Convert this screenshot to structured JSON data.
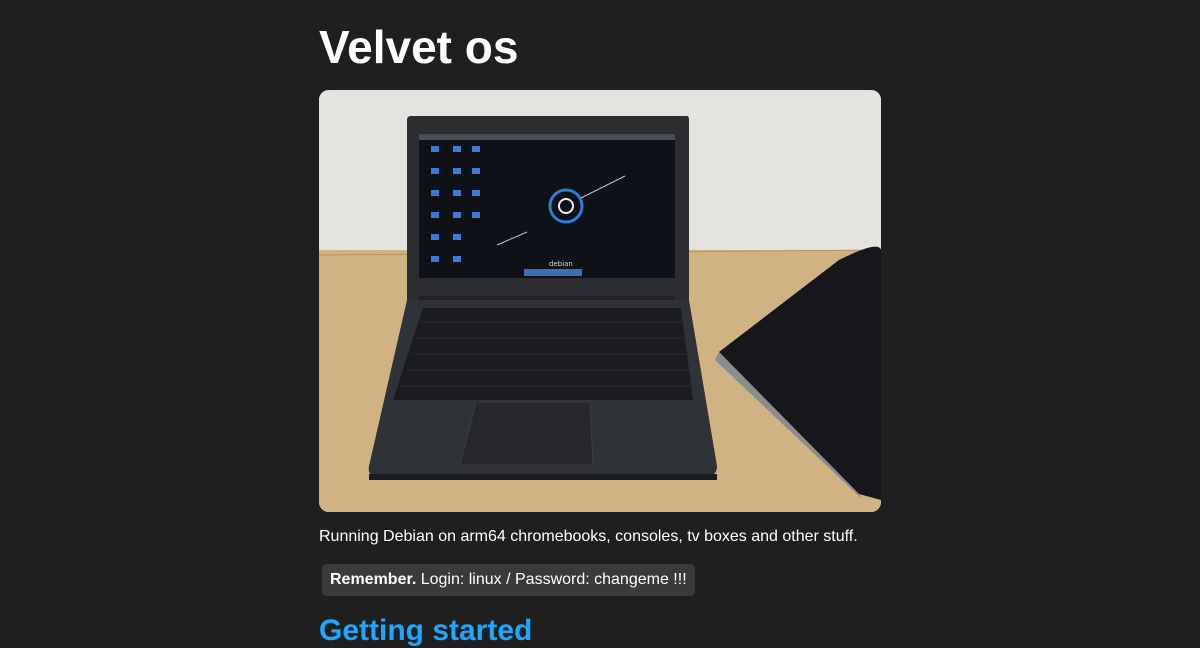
{
  "header": {
    "title": "Velvet os"
  },
  "hero": {
    "screen_label": "debian"
  },
  "intro": {
    "description": "Running Debian on arm64 chromebooks, consoles, tv boxes and other stuff."
  },
  "notice": {
    "strong": "Remember.",
    "text": " Login: linux / Password: changeme !!!"
  },
  "sections": {
    "getting_started": "Getting started"
  },
  "colors": {
    "background": "#1f1f1f",
    "link": "#1ea7ff",
    "note_bg": "#3a3a3a"
  }
}
